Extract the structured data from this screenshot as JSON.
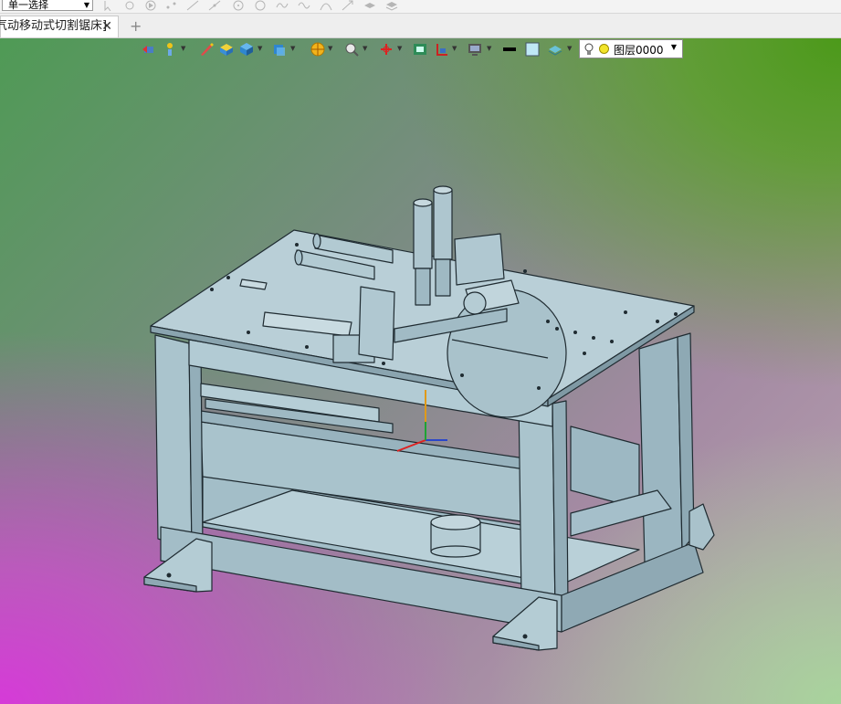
{
  "selection": {
    "mode": "单一选择"
  },
  "document_tab": {
    "title": "气动移动式切割锯床]",
    "close_glyph": "✕"
  },
  "new_tab_glyph": "+",
  "toolbar": {
    "layer_value": "图层0000",
    "icons": [
      "view-orient-icon",
      "pick-filter-icon",
      "pencil-icon",
      "shaded-icon",
      "box-view-icon",
      "front-view-icon",
      "render-mode-icon",
      "zoom-icon",
      "origin-icon",
      "fit-view-icon",
      "section-icon",
      "display-icon",
      "line-color-swatch",
      "fill-color-swatch",
      "layer-visibility-icon"
    ]
  },
  "colors": {
    "model_fill": "#a8c2cc",
    "model_edge": "#1f2b31",
    "background_top_right": "#4c9a1a",
    "background_bottom_left": "#d63ad8"
  }
}
